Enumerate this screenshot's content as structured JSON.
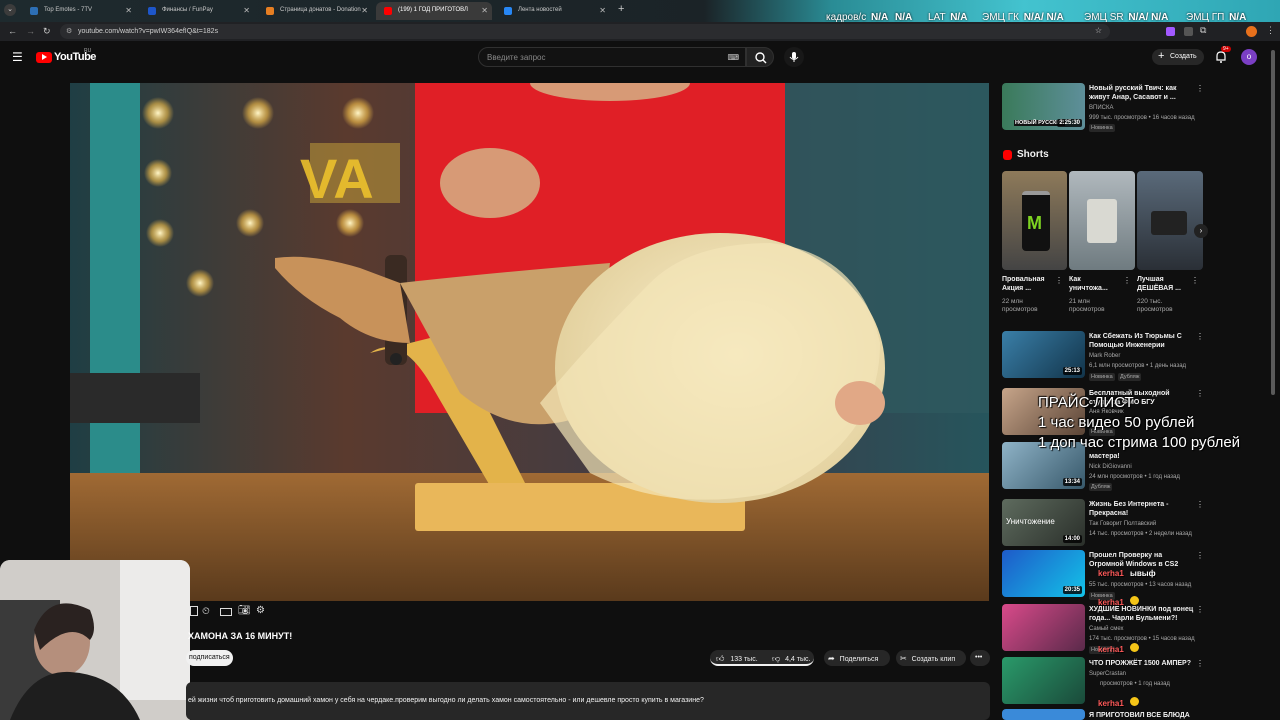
{
  "browser": {
    "tabs": [
      {
        "label": "Top Emotes - 7TV",
        "active": false
      },
      {
        "label": "Финансы / FunPay",
        "active": false
      },
      {
        "label": "Страница донатов - Donation",
        "active": false
      },
      {
        "label": "(199) 1 ГОД ПРИГОТОВЛ",
        "active": true
      },
      {
        "label": "Лента новостей",
        "active": false
      }
    ],
    "url": "youtube.com/watch?v=pwIW364efIQ&t=182s"
  },
  "osd_stats": [
    {
      "label": "кадров/с",
      "value": "N/A"
    },
    {
      "label": "",
      "value": "N/A"
    },
    {
      "label": "LAT",
      "value": "N/A"
    },
    {
      "label": "ЭМЦ ГК",
      "value": "N/A/ N/A"
    },
    {
      "label": "ЭМЦ SR",
      "value": "N/A/ N/A"
    },
    {
      "label": "ЭМЦ ГП",
      "value": "N/A"
    }
  ],
  "youtube": {
    "logo": "YouTube",
    "logo_region": "RU",
    "search_placeholder": "Введите запрос",
    "create_label": "Создать",
    "notif_count": "9+",
    "avatar_letter": "о"
  },
  "video": {
    "title": "ХАМОНА ЗА 16 МИНУТ!",
    "subscribe_label": "подписаться",
    "likes": "133 тыс.",
    "dislikes": "4,4 тыс.",
    "share_label": "Поделиться",
    "clip_label": "Создать клип",
    "description": "ей жизни чтоб приготовить домашний хамон у себя на чердаке.проверим выгодно ли делать хамон самостоятельно - или дешевле просто купить в магазине?"
  },
  "sidebar": {
    "top_video": {
      "title_line1": "Новый русский Твич: как",
      "title_line2": "живут Анар, Сасавот и ...",
      "channel": "ВПИСКА",
      "meta": "999 тыс. просмотров • 16 часов назад",
      "badge": "Новинка",
      "duration": "2:25:30",
      "thumb_label": "НОВЫЙ РУССКИЙ"
    },
    "shorts_heading": "Shorts",
    "shorts": [
      {
        "title_line1": "Провальная",
        "title_line2": "Акция ...",
        "views_line1": "22 млн",
        "views_line2": "просмотров"
      },
      {
        "title_line1": "Как",
        "title_line2": "уничтожа...",
        "views_line1": "21 млн",
        "views_line2": "просмотров"
      },
      {
        "title_line1": "Лучшая",
        "title_line2": "ДЕШЁВАЯ ...",
        "views_line1": "220 тыс.",
        "views_line2": "просмотров"
      }
    ],
    "videos": [
      {
        "title_line1": "Как Сбежать Из Тюрьмы С",
        "title_line2": "Помощью Инженерии",
        "channel": "Mark Rober",
        "meta": "6,1 млн просмотров • 1 день назад",
        "badges": [
          "Новинка",
          "Дубляж"
        ],
        "duration": "25:13"
      },
      {
        "title_line1": "Бесплатный выходной",
        "title_line2": "студента ФМО БГУ",
        "channel": "Аня Яковчик",
        "meta": "",
        "badges": [
          "Новинка"
        ],
        "duration": ""
      },
      {
        "title_line1": "",
        "title_line2": "мастера!",
        "channel": "Nick DiGiovanni",
        "meta": "24 млн просмотров • 1 год назад",
        "badges": [
          "Дубляж"
        ],
        "duration": "13:34"
      },
      {
        "title_line1": "Жизнь Без Интернета -",
        "title_line2": "Прекрасна!",
        "channel": "Так Говорит Полтавский",
        "meta": "14 тыс. просмотров • 2 недели назад",
        "badges": [],
        "duration": "14:00",
        "thumb_label": "Уничтожение"
      },
      {
        "title_line1": "Прошел Проверку на",
        "title_line2": "Огромной Windows в CS2",
        "channel": "",
        "meta": "55 тыс. просмотров • 13 часов назад",
        "badges": [
          "Новинка"
        ],
        "duration": "20:35"
      },
      {
        "title_line1": "ХУДШИЕ НОВИНКИ под конец",
        "title_line2": "года... Чарли Бульмени?!",
        "channel": "Самый смех",
        "meta": "174 тыс. просмотров • 15 часов назад",
        "badges": [
          "Новинка"
        ],
        "duration": ""
      },
      {
        "title_line1": "ЧТО ПРОЖЖЁТ 1500 АМПЕР?",
        "title_line2": "",
        "channel": "SuperCrastan",
        "meta": "просмотров • 1 год назад",
        "badges": [],
        "duration": ""
      },
      {
        "title_line1": "Я ПРИГОТОВИЛ ВСЕ БЛЮДА",
        "title_line2": "",
        "channel": "",
        "meta": "",
        "badges": [],
        "duration": ""
      }
    ]
  },
  "stream_overlay": {
    "price_title": "ПРАЙС ЛИСТ",
    "price_line1": "1 час видео 50 рублей",
    "price_line2": "1 доп час стрима 100 рублей",
    "chat": [
      {
        "user": "kerha1",
        "text": "ывыф"
      },
      {
        "user": "kerha1",
        "text": ""
      },
      {
        "user": "kerha1",
        "text": ""
      },
      {
        "user": "kerha1",
        "text": ""
      }
    ]
  },
  "colors": {
    "bg": "#0f0f0f",
    "youtube_red": "#ff0000",
    "accent_purple": "#8e44ad",
    "chip": "#272727"
  }
}
